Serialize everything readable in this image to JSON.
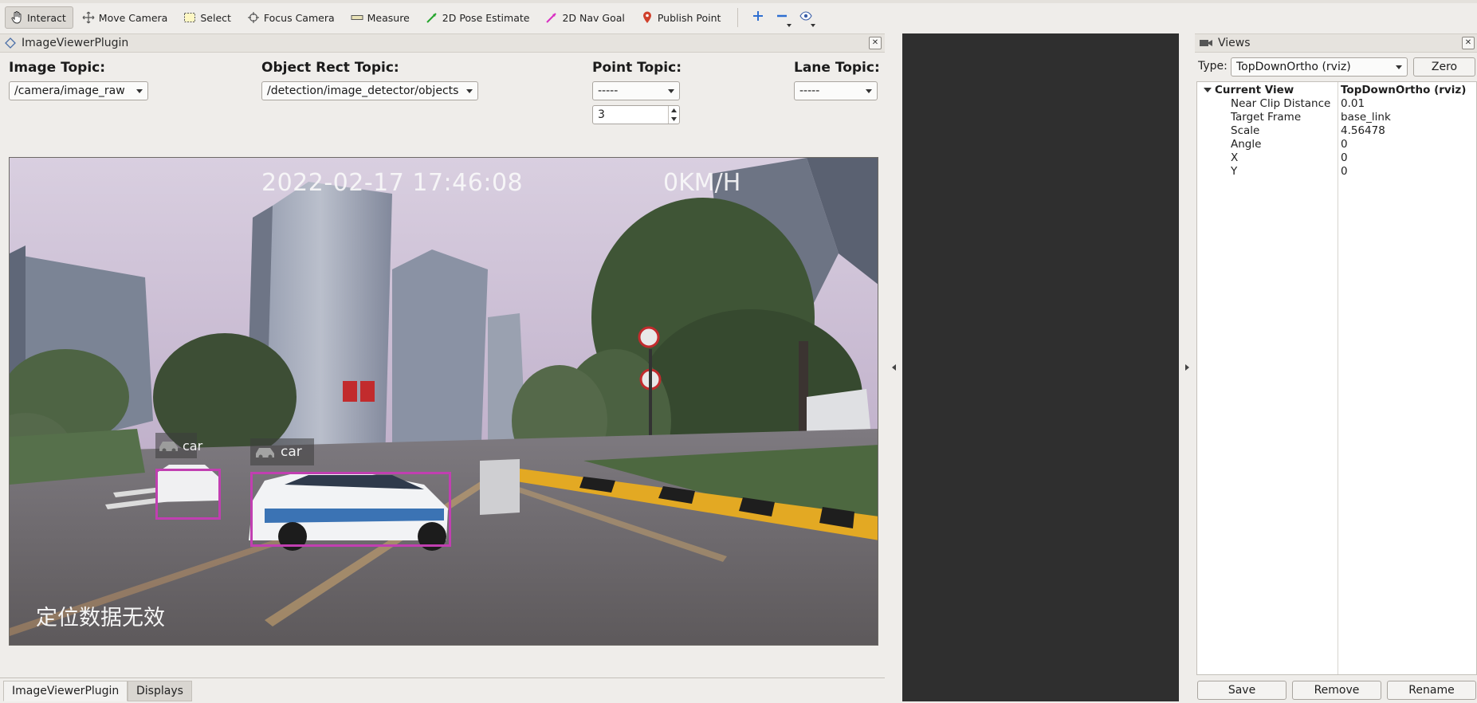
{
  "toolbar": {
    "tools": [
      {
        "label": "Interact",
        "icon": "hand-icon"
      },
      {
        "label": "Move Camera",
        "icon": "move-camera-icon"
      },
      {
        "label": "Select",
        "icon": "select-icon"
      },
      {
        "label": "Focus Camera",
        "icon": "focus-camera-icon"
      },
      {
        "label": "Measure",
        "icon": "ruler-icon"
      },
      {
        "label": "2D Pose Estimate",
        "icon": "green-arrow-icon"
      },
      {
        "label": "2D Nav Goal",
        "icon": "pink-arrow-icon"
      },
      {
        "label": "Publish Point",
        "icon": "map-pin-icon"
      }
    ],
    "active_tool": "Interact"
  },
  "image_viewer": {
    "title": "ImageViewerPlugin",
    "image_topic": {
      "label": "Image Topic:",
      "value": "/camera/image_raw"
    },
    "object_rect_topic": {
      "label": "Object Rect Topic:",
      "value": "/detection/image_detector/objects"
    },
    "point_topic": {
      "label": "Point Topic:",
      "value": "-----",
      "size": "3"
    },
    "lane_topic": {
      "label": "Lane Topic:",
      "value": "-----"
    },
    "camera_image": {
      "timestamp": "2022-02-17 17:46:08",
      "speed": "0KM/H",
      "status_text": "定位数据无效",
      "detections": [
        {
          "label": "car"
        },
        {
          "label": "car"
        }
      ]
    }
  },
  "bottom_tabs": [
    {
      "label": "ImageViewerPlugin",
      "selected": true
    },
    {
      "label": "Displays",
      "selected": false
    }
  ],
  "views": {
    "title": "Views",
    "type_label": "Type:",
    "type_value": "TopDownOrtho (rviz)",
    "zero_label": "Zero",
    "current_view": {
      "name": "Current View",
      "value": "TopDownOrtho (rviz)"
    },
    "properties": [
      {
        "name": "Near Clip Distance",
        "value": "0.01"
      },
      {
        "name": "Target Frame",
        "value": "base_link"
      },
      {
        "name": "Scale",
        "value": "4.56478"
      },
      {
        "name": "Angle",
        "value": "0"
      },
      {
        "name": "X",
        "value": "0"
      },
      {
        "name": "Y",
        "value": "0"
      }
    ],
    "buttons": {
      "save": "Save",
      "remove": "Remove",
      "rename": "Rename"
    }
  },
  "colors": {
    "detection_box": "#c13fb1",
    "render_background": "#2f2f2f",
    "panel_background": "#efedea"
  }
}
